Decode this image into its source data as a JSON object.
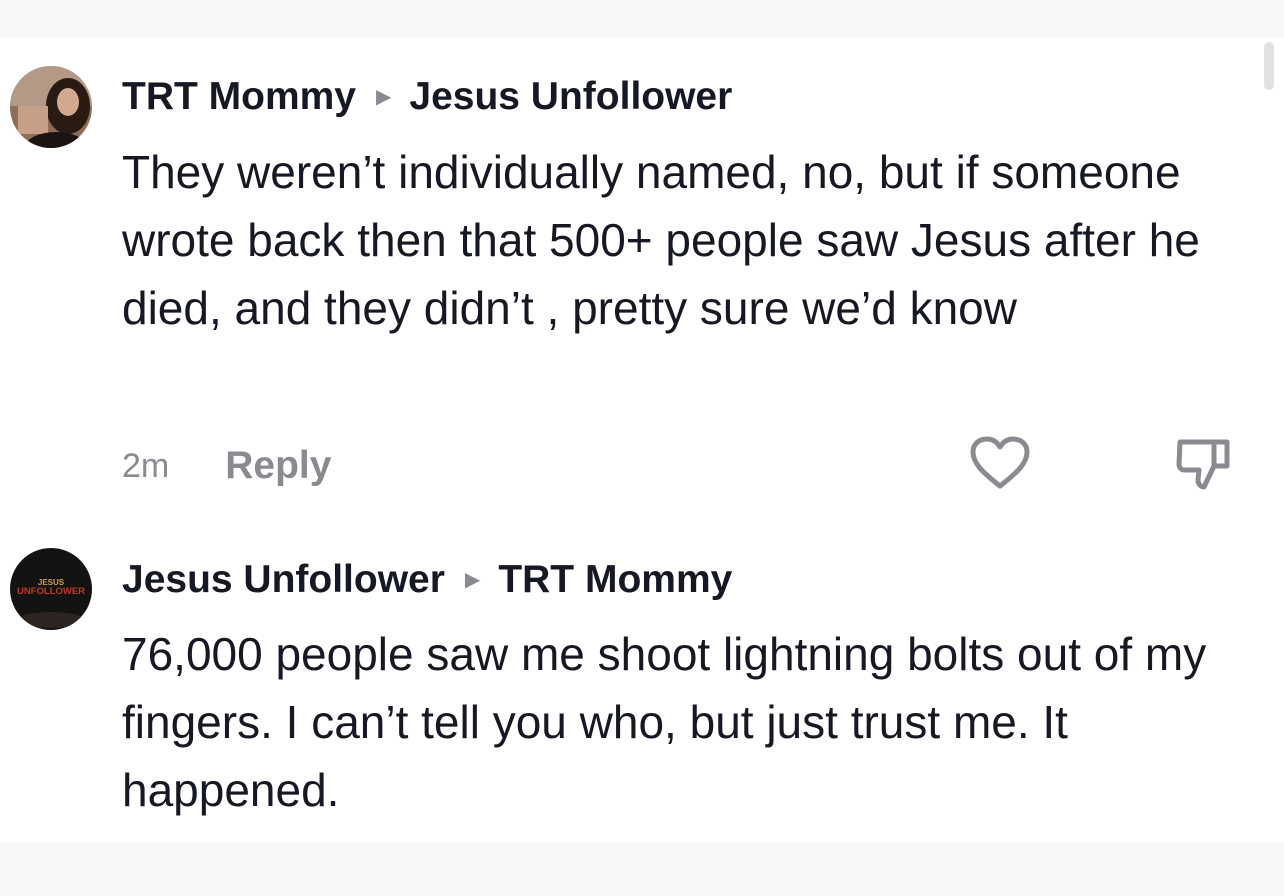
{
  "comments": [
    {
      "author": "TRT Mommy",
      "reply_to": "Jesus Unfollower",
      "text": "They weren’t individually named, no, but if someone wrote back then that 500+ people saw Jesus after he died, and they didn’t , pretty sure we’d know",
      "time": "2m",
      "reply_label": "Reply",
      "avatar_icon": "user-photo",
      "actions": [
        "heart-icon",
        "dislike-icon"
      ]
    },
    {
      "author": "Jesus Unfollower",
      "reply_to": "TRT Mommy",
      "text": "76,000 people saw me shoot lightning bolts out of my fingers. I can’t tell you who, but just trust me. It happened.",
      "avatar_logo": {
        "top": "JESUS",
        "bottom": "UNFOLLOWER"
      }
    }
  ],
  "colors": {
    "text": "#161823",
    "muted": "#8a8b91",
    "logo_red": "#c0392b",
    "logo_gold": "#c8a14a"
  }
}
